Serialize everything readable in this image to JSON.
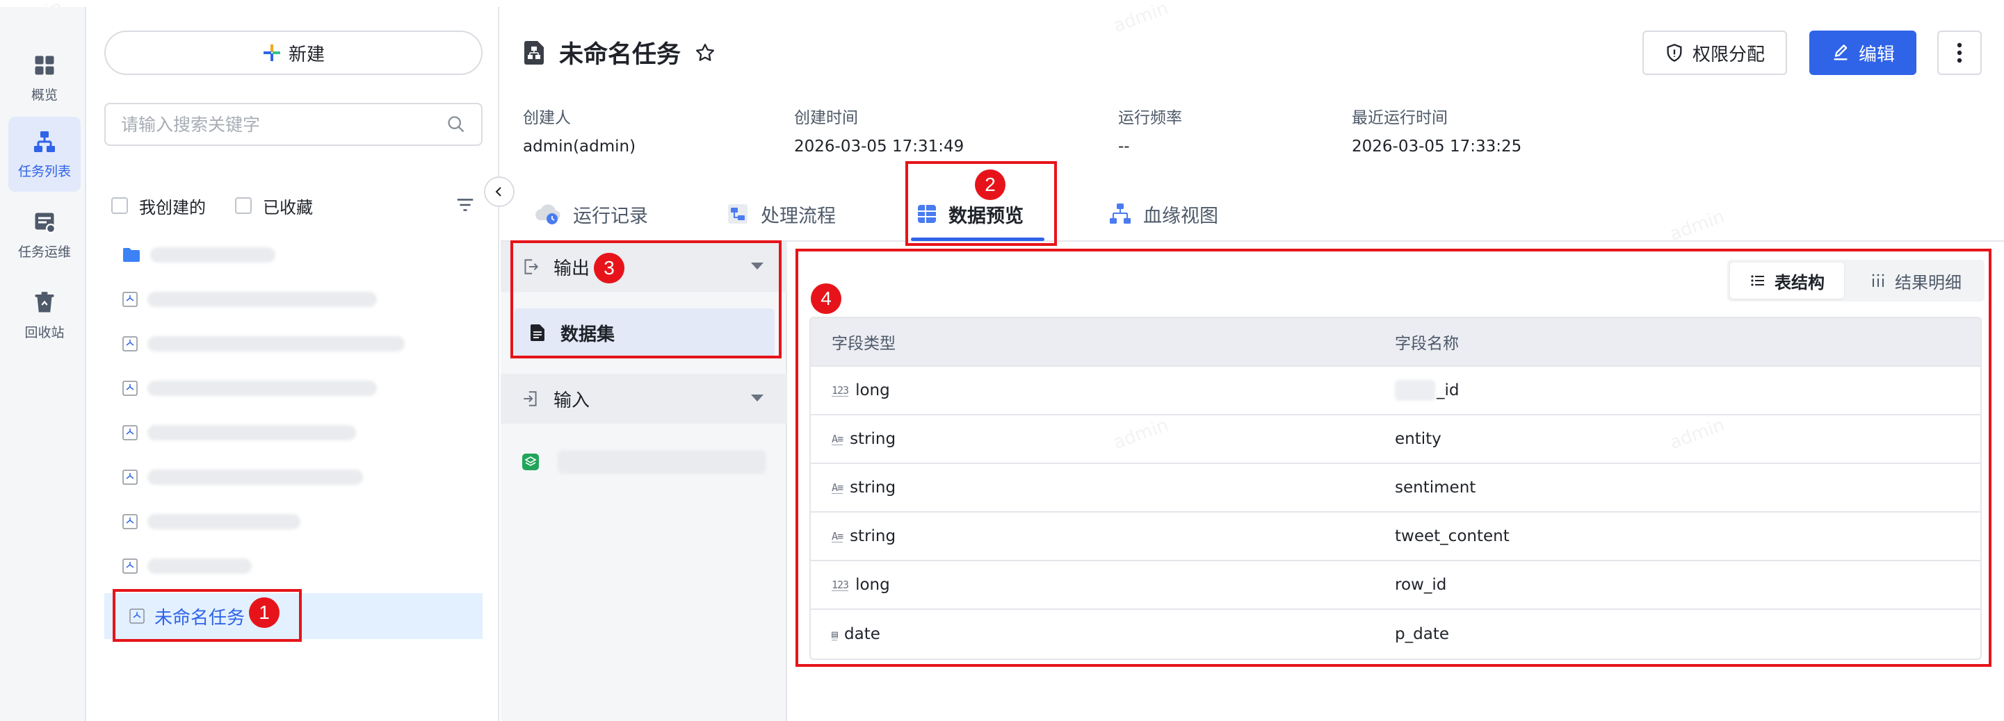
{
  "nav": {
    "items": [
      {
        "label": "概览",
        "icon": "grid-icon"
      },
      {
        "label": "任务列表",
        "icon": "tree-icon",
        "active": true
      },
      {
        "label": "任务运维",
        "icon": "ops-icon"
      },
      {
        "label": "回收站",
        "icon": "trash-icon"
      }
    ]
  },
  "panel": {
    "new_label": "新建",
    "search_placeholder": "请输入搜索关键字",
    "filters": [
      "我创建的",
      "已收藏"
    ],
    "selected_task": "未命名任务"
  },
  "header": {
    "title": "未命名任务",
    "permission_label": "权限分配",
    "edit_label": "编辑",
    "meta": [
      {
        "label": "创建人",
        "value": "admin(admin)"
      },
      {
        "label": "创建时间",
        "value": "2026-03-05 17:31:49"
      },
      {
        "label": "运行频率",
        "value": "--"
      },
      {
        "label": "最近运行时间",
        "value": "2026-03-05 17:33:25"
      }
    ]
  },
  "tabs": [
    {
      "label": "运行记录"
    },
    {
      "label": "处理流程"
    },
    {
      "label": "数据预览",
      "active": true
    },
    {
      "label": "血缘视图"
    }
  ],
  "io": {
    "output_label": "输出",
    "output_item": "数据集",
    "input_label": "输入"
  },
  "view_toggle": {
    "structure_label": "表结构",
    "detail_label": "结果明细"
  },
  "table": {
    "headers": [
      "字段类型",
      "字段名称"
    ],
    "rows": [
      {
        "type_icon": "123",
        "type": "long",
        "name": "_id"
      },
      {
        "type_icon": "A≡",
        "type": "string",
        "name": "entity"
      },
      {
        "type_icon": "A≡",
        "type": "string",
        "name": "sentiment"
      },
      {
        "type_icon": "A≡",
        "type": "string",
        "name": "tweet_content"
      },
      {
        "type_icon": "123",
        "type": "long",
        "name": "row_id"
      },
      {
        "type_icon": "▤",
        "type": "date",
        "name": "p_date"
      }
    ]
  },
  "annotations": [
    "1",
    "2",
    "3",
    "4"
  ],
  "watermark": "admin",
  "colors": {
    "accent": "#2f64e8",
    "annotation": "#e6141a"
  }
}
